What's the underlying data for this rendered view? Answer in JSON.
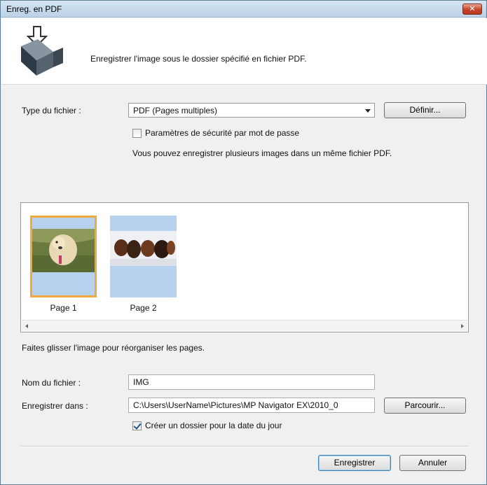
{
  "window": {
    "title": "Enreg. en PDF",
    "close_glyph": "✕"
  },
  "header": {
    "text": "Enregistrer l'image sous le dossier spécifié en fichier PDF.",
    "icon": "save-to-folder-icon"
  },
  "file_type": {
    "label": "Type du fichier :",
    "selected": "PDF (Pages multiples)",
    "define_button": "Définir..."
  },
  "security": {
    "label": "Paramètres de sécurité par mot de passe",
    "checked": false
  },
  "info_text": "Vous pouvez enregistrer plusieurs images dans un même fichier PDF.",
  "pages": [
    {
      "label": "Page 1",
      "selected": true
    },
    {
      "label": "Page 2",
      "selected": false
    }
  ],
  "drag_hint": "Faites glisser l'image pour réorganiser les pages.",
  "file_name": {
    "label": "Nom du fichier :",
    "value": "IMG"
  },
  "save_in": {
    "label": "Enregistrer dans :",
    "value": "C:\\Users\\UserName\\Pictures\\MP Navigator EX\\2010_0",
    "browse_button": "Parcourir..."
  },
  "date_folder": {
    "label": "Créer un dossier pour la date du jour",
    "checked": true
  },
  "buttons": {
    "save": "Enregistrer",
    "cancel": "Annuler"
  },
  "colors": {
    "selection_border": "#f2a83a",
    "thumb_bg": "#b7d2ef"
  }
}
